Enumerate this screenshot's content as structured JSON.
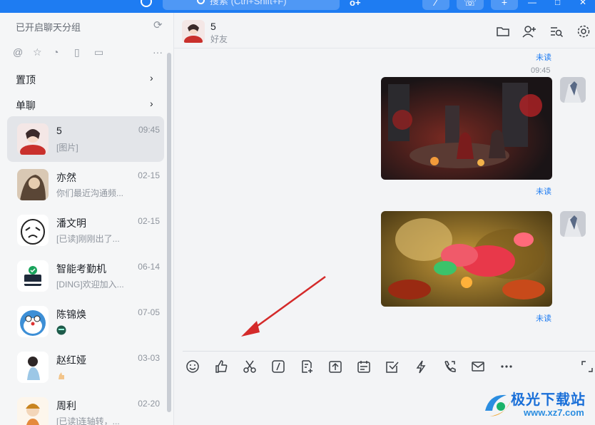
{
  "topbar": {
    "search_placeholder": "搜索 (Ctrl+Shift+F)",
    "org_label": "o+",
    "buttons": [
      "⁄",
      "☏",
      "+"
    ],
    "window_controls": [
      "—",
      "□",
      "✕"
    ]
  },
  "sidebar": {
    "header": "已开启聊天分组",
    "tool_icons": [
      "at-icon",
      "star-icon",
      "history-icon",
      "file-icon",
      "doc-icon",
      "more-icon"
    ],
    "pinned_label": "置顶",
    "single_chat_label": "单聊",
    "conversations": [
      {
        "name": "5",
        "time": "09:45",
        "preview": "[图片]",
        "active": true
      },
      {
        "name": "亦然",
        "time": "02-15",
        "preview": "你们最近沟通频..."
      },
      {
        "name": "潘文明",
        "time": "02-15",
        "preview": "[已读]刚刚出了..."
      },
      {
        "name": "智能考勤机",
        "time": "06-14",
        "preview": "[DING]欢迎加入..."
      },
      {
        "name": "陈锦焕",
        "time": "07-05",
        "preview": ""
      },
      {
        "name": "赵红娅",
        "time": "03-03",
        "preview": ""
      },
      {
        "name": "周利",
        "time": "02-20",
        "preview": "[已读]连轴转，..."
      }
    ]
  },
  "chat": {
    "name": "5",
    "subtitle": "好友",
    "header_icons": [
      "folder-icon",
      "add-member-icon",
      "search-history-icon",
      "settings-icon"
    ],
    "messages": [
      {
        "unread_label": "未读"
      },
      {
        "time": "09:45",
        "type": "image",
        "unread_label": "未读"
      },
      {
        "type": "image",
        "unread_label": "未读"
      }
    ]
  },
  "composer": {
    "tool_icons": [
      "emoji-icon",
      "thumbs-up-icon",
      "scissors-icon",
      "slash-icon",
      "note-icon",
      "upload-icon",
      "calendar-icon",
      "task-icon",
      "lightning-icon",
      "phone-icon",
      "mail-icon",
      "more-icon",
      "expand-icon"
    ]
  },
  "watermark": {
    "title": "极光下载站",
    "url": "www.xz7.com"
  },
  "colors": {
    "accent": "#1e7cf2",
    "arrow": "#d42a2a"
  }
}
